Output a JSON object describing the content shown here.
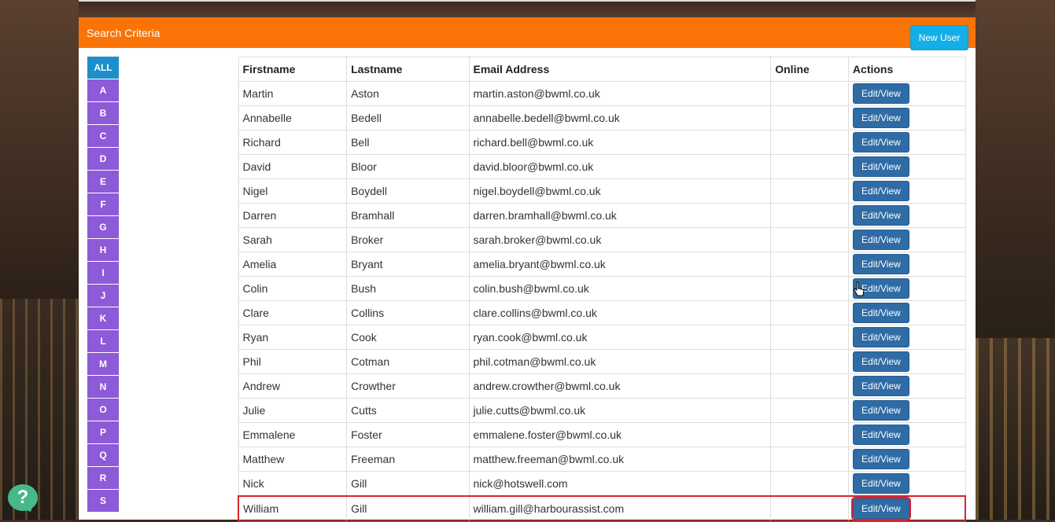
{
  "header": {
    "title": "Search Criteria",
    "new_user_label": "New User"
  },
  "letters": [
    "ALL",
    "A",
    "B",
    "C",
    "D",
    "E",
    "F",
    "G",
    "H",
    "I",
    "J",
    "K",
    "L",
    "M",
    "N",
    "O",
    "P",
    "Q",
    "R",
    "S"
  ],
  "table": {
    "columns": [
      "Firstname",
      "Lastname",
      "Email Address",
      "Online",
      "Actions"
    ],
    "action_label": "Edit/View",
    "rows": [
      {
        "first": "Martin",
        "last": "Aston",
        "email": "martin.aston@bwml.co.uk",
        "online": ""
      },
      {
        "first": "Annabelle",
        "last": "Bedell",
        "email": "annabelle.bedell@bwml.co.uk",
        "online": ""
      },
      {
        "first": "Richard",
        "last": "Bell",
        "email": "richard.bell@bwml.co.uk",
        "online": ""
      },
      {
        "first": "David",
        "last": "Bloor",
        "email": "david.bloor@bwml.co.uk",
        "online": ""
      },
      {
        "first": "Nigel",
        "last": "Boydell",
        "email": "nigel.boydell@bwml.co.uk",
        "online": ""
      },
      {
        "first": "Darren",
        "last": "Bramhall",
        "email": "darren.bramhall@bwml.co.uk",
        "online": ""
      },
      {
        "first": "Sarah",
        "last": "Broker",
        "email": "sarah.broker@bwml.co.uk",
        "online": ""
      },
      {
        "first": "Amelia",
        "last": "Bryant",
        "email": "amelia.bryant@bwml.co.uk",
        "online": ""
      },
      {
        "first": "Colin",
        "last": "Bush",
        "email": "colin.bush@bwml.co.uk",
        "online": ""
      },
      {
        "first": "Clare",
        "last": "Collins",
        "email": "clare.collins@bwml.co.uk",
        "online": ""
      },
      {
        "first": "Ryan",
        "last": "Cook",
        "email": "ryan.cook@bwml.co.uk",
        "online": ""
      },
      {
        "first": "Phil",
        "last": "Cotman",
        "email": "phil.cotman@bwml.co.uk",
        "online": ""
      },
      {
        "first": "Andrew",
        "last": "Crowther",
        "email": "andrew.crowther@bwml.co.uk",
        "online": ""
      },
      {
        "first": "Julie",
        "last": "Cutts",
        "email": "julie.cutts@bwml.co.uk",
        "online": ""
      },
      {
        "first": "Emmalene",
        "last": "Foster",
        "email": "emmalene.foster@bwml.co.uk",
        "online": ""
      },
      {
        "first": "Matthew",
        "last": "Freeman",
        "email": "matthew.freeman@bwml.co.uk",
        "online": ""
      },
      {
        "first": "Nick",
        "last": "Gill",
        "email": "nick@hotswell.com",
        "online": ""
      },
      {
        "first": "William",
        "last": "Gill",
        "email": "william.gill@harbourassist.com",
        "online": ""
      }
    ]
  },
  "help": {
    "icon": "question-icon",
    "label": "?"
  },
  "colors": {
    "header_bg": "#f97306",
    "new_user_bg": "#14aee8",
    "letter_bg": "#8d5ad8",
    "letter_active_bg": "#1b8fc9",
    "edit_btn_bg": "#2f6ba5",
    "highlight": "#d9262c"
  }
}
